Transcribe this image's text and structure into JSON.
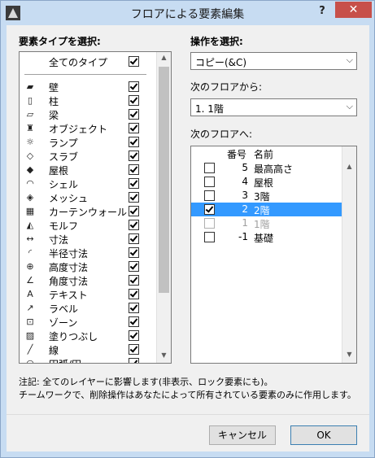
{
  "window": {
    "title": "フロアによる要素編集",
    "help": "?",
    "close": "✕"
  },
  "left": {
    "heading": "要素タイプを選択:",
    "all_label": "全てのタイプ",
    "all_checked": true,
    "types": [
      {
        "label": "壁",
        "icon": "wall-icon",
        "glyph": "▰",
        "checked": true
      },
      {
        "label": "柱",
        "icon": "column-icon",
        "glyph": "▯",
        "checked": true
      },
      {
        "label": "梁",
        "icon": "beam-icon",
        "glyph": "▱",
        "checked": true
      },
      {
        "label": "オブジェクト",
        "icon": "object-icon",
        "glyph": "♜",
        "checked": true
      },
      {
        "label": "ランプ",
        "icon": "lamp-icon",
        "glyph": "☼",
        "checked": true
      },
      {
        "label": "スラブ",
        "icon": "slab-icon",
        "glyph": "◇",
        "checked": true
      },
      {
        "label": "屋根",
        "icon": "roof-icon",
        "glyph": "◆",
        "checked": true
      },
      {
        "label": "シェル",
        "icon": "shell-icon",
        "glyph": "◠",
        "checked": true
      },
      {
        "label": "メッシュ",
        "icon": "mesh-icon",
        "glyph": "◈",
        "checked": true
      },
      {
        "label": "カーテンウォール",
        "icon": "curtain-wall-icon",
        "glyph": "▦",
        "checked": true
      },
      {
        "label": "モルフ",
        "icon": "morph-icon",
        "glyph": "◭",
        "checked": true
      },
      {
        "label": "寸法",
        "icon": "dimension-icon",
        "glyph": "↔",
        "checked": true
      },
      {
        "label": "半径寸法",
        "icon": "radial-dimension-icon",
        "glyph": "◜",
        "checked": true
      },
      {
        "label": "高度寸法",
        "icon": "level-dimension-icon",
        "glyph": "⊕",
        "checked": true
      },
      {
        "label": "角度寸法",
        "icon": "angle-dimension-icon",
        "glyph": "∠",
        "checked": true
      },
      {
        "label": "テキスト",
        "icon": "text-icon",
        "glyph": "A",
        "checked": true
      },
      {
        "label": "ラベル",
        "icon": "label-icon",
        "glyph": "↗",
        "checked": true
      },
      {
        "label": "ゾーン",
        "icon": "zone-icon",
        "glyph": "⊡",
        "checked": true
      },
      {
        "label": "塗りつぶし",
        "icon": "fill-icon",
        "glyph": "▨",
        "checked": true
      },
      {
        "label": "線",
        "icon": "line-icon",
        "glyph": "╱",
        "checked": true
      },
      {
        "label": "円弧/円",
        "icon": "arc-icon",
        "glyph": "◠",
        "checked": true
      }
    ]
  },
  "right": {
    "operation_heading": "操作を選択:",
    "operation_value": "コピー(&C)",
    "from_label": "次のフロアから:",
    "from_value": "1. 1階",
    "to_label": "次のフロアへ:",
    "col_number": "番号",
    "col_name": "名前",
    "floors": [
      {
        "num": "5",
        "name": "最高高さ",
        "checked": false,
        "state": "normal"
      },
      {
        "num": "4",
        "name": "屋根",
        "checked": false,
        "state": "normal"
      },
      {
        "num": "3",
        "name": "3階",
        "checked": false,
        "state": "normal"
      },
      {
        "num": "2",
        "name": "2階",
        "checked": true,
        "state": "selected"
      },
      {
        "num": "1",
        "name": "1階",
        "checked": false,
        "state": "disabled"
      },
      {
        "num": "-1",
        "name": "基礎",
        "checked": false,
        "state": "normal"
      }
    ]
  },
  "note": {
    "line1": "注記: 全てのレイヤーに影響します(非表示、ロック要素にも)。",
    "line2": "チームワークで、削除操作はあなたによって所有されている要素のみに作用します。"
  },
  "buttons": {
    "cancel": "キャンセル",
    "ok": "OK"
  }
}
